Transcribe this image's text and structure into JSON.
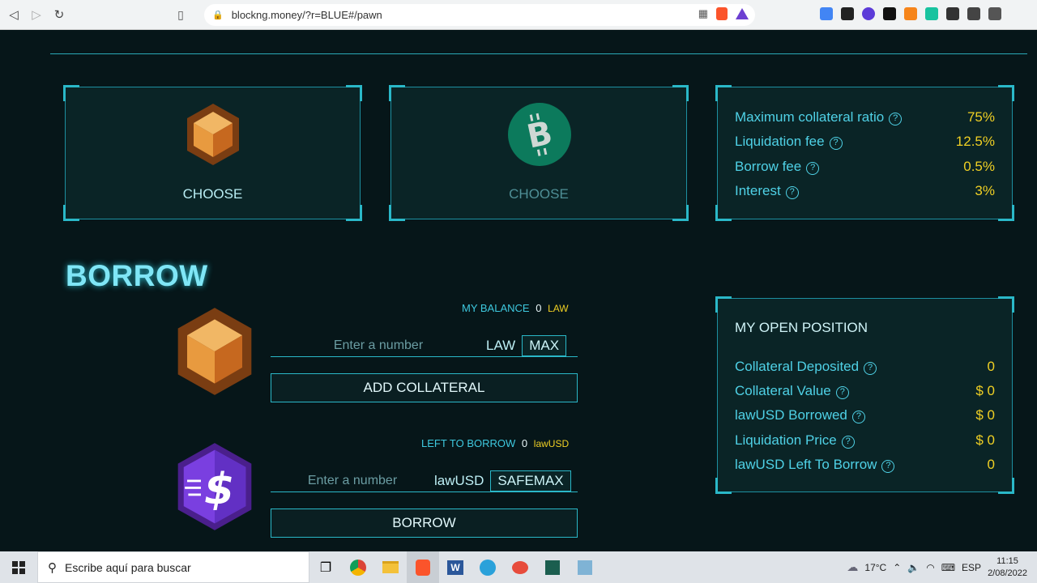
{
  "browser": {
    "url": "blockng.money/?r=BLUE#/pawn"
  },
  "collateral_cards": [
    {
      "label": "CHOOSE"
    },
    {
      "label": "CHOOSE"
    }
  ],
  "params": [
    {
      "label": "Maximum collateral ratio",
      "value": "75%"
    },
    {
      "label": "Liquidation fee",
      "value": "12.5%"
    },
    {
      "label": "Borrow fee",
      "value": "0.5%"
    },
    {
      "label": "Interest",
      "value": "3%"
    }
  ],
  "borrow": {
    "title": "BORROW",
    "balance_label": "MY BALANCE",
    "balance_value": "0",
    "balance_unit": "LAW",
    "collateral_placeholder": "Enter a number",
    "collateral_unit": "LAW",
    "max_label": "MAX",
    "add_collateral_label": "ADD COLLATERAL",
    "left_label": "LEFT TO BORROW",
    "left_value": "0",
    "left_unit": "lawUSD",
    "borrow_placeholder": "Enter a number",
    "borrow_unit": "lawUSD",
    "safemax_label": "SAFEMAX",
    "borrow_button_label": "BORROW"
  },
  "position": {
    "title": "MY OPEN POSITION",
    "rows": [
      {
        "label": "Collateral Deposited",
        "value": "0"
      },
      {
        "label": "Collateral Value",
        "value": "$ 0"
      },
      {
        "label": "lawUSD Borrowed",
        "value": "$ 0"
      },
      {
        "label": "Liquidation Price",
        "value": "$ 0"
      },
      {
        "label": "lawUSD Left To Borrow",
        "value": "0"
      }
    ]
  },
  "taskbar": {
    "search_placeholder": "Escribe aquí para buscar",
    "weather": "17°C",
    "language": "ESP",
    "time": "11:15",
    "date": "2/08/2022"
  }
}
